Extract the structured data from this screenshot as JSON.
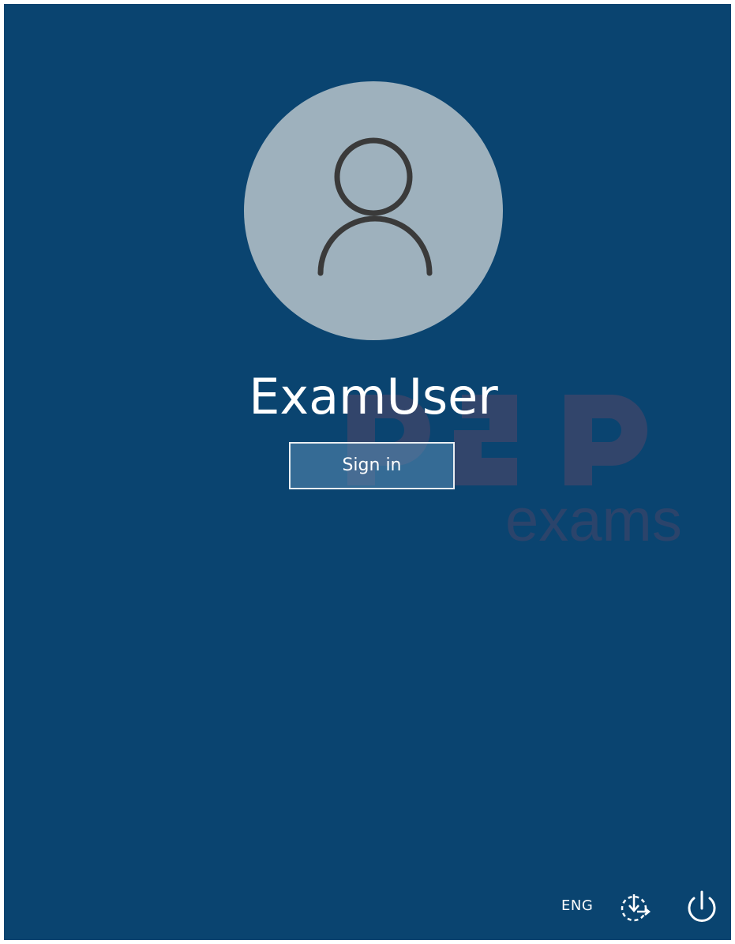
{
  "user": {
    "name": "ExamUser",
    "avatar_icon": "user-silhouette-icon"
  },
  "signin": {
    "label": "Sign in"
  },
  "tray": {
    "language": "ENG",
    "ease_icon": "ease-of-access-icon",
    "power_icon": "power-icon"
  },
  "watermark": {
    "text_top": "P2P",
    "text_bottom": "exams"
  },
  "colors": {
    "background": "#0a4470",
    "avatar": "#9eb1bd",
    "watermark": "#c44a5a"
  }
}
